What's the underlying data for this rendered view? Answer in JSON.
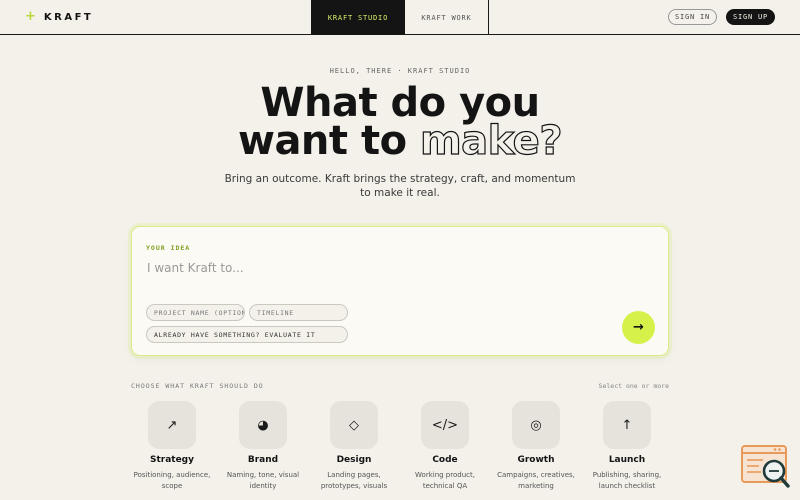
{
  "header": {
    "logo_mark": "+",
    "logo_text": "KRAFT",
    "tabs": [
      {
        "label": "KRAFT STUDIO",
        "active": true
      },
      {
        "label": "KRAFT WORK",
        "active": false
      }
    ],
    "signin_label": "SIGN IN",
    "signup_label": "SIGN UP"
  },
  "hero": {
    "eyebrow": "HELLO, THERE · KRAFT STUDIO",
    "headline_line1": "What do you",
    "headline_line2_solid": "want to ",
    "headline_line2_outline": "make?",
    "subtitle": "Bring an outcome. Kraft brings the strategy, craft, and momentum to make it real."
  },
  "idea_card": {
    "label": "YOUR IDEA",
    "input_placeholder": "I want Kraft to...",
    "chip_project": "PROJECT NAME (OPTIONAL)",
    "chip_timeline": "TIMELINE",
    "chip_evaluate": "ALREADY HAVE SOMETHING? EVALUATE IT",
    "submit_icon": "→"
  },
  "services": {
    "label": "CHOOSE WHAT KRAFT SHOULD DO",
    "hint": "Select one or more",
    "items": [
      {
        "icon": "↗",
        "icon_name": "arrow-up-right-icon",
        "name": "Strategy",
        "desc": "Positioning, audience, scope"
      },
      {
        "icon": "◕",
        "icon_name": "pie-icon",
        "name": "Brand",
        "desc": "Naming, tone, visual identity"
      },
      {
        "icon": "◇",
        "icon_name": "diamond-icon",
        "name": "Design",
        "desc": "Landing pages, prototypes, visuals"
      },
      {
        "icon": "</>",
        "icon_name": "code-icon",
        "name": "Code",
        "desc": "Working product, technical QA"
      },
      {
        "icon": "◎",
        "icon_name": "target-icon",
        "name": "Growth",
        "desc": "Campaigns, creatives, marketing"
      },
      {
        "icon": "↑",
        "icon_name": "arrow-up-icon",
        "name": "Launch",
        "desc": "Publishing, sharing, launch checklist"
      }
    ]
  },
  "colors": {
    "background": "#f3f1ea",
    "ink": "#141414",
    "accent": "#d6f24a",
    "accent_text": "#7fa020"
  }
}
